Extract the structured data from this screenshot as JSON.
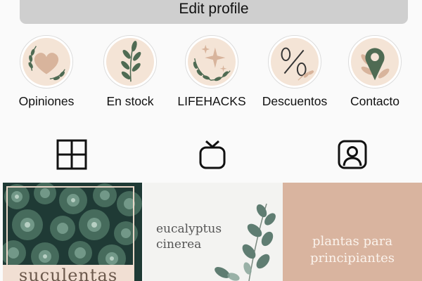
{
  "profile": {
    "edit_button_label": "Edit profile"
  },
  "highlights": [
    {
      "label": "Opiniones",
      "icon": "heart-wreath-icon"
    },
    {
      "label": "En stock",
      "icon": "leaf-branch-icon"
    },
    {
      "label": "LIFEHACKS",
      "icon": "sparkles-wreath-icon"
    },
    {
      "label": "Descuentos",
      "icon": "percent-icon"
    },
    {
      "label": "Contacto",
      "icon": "location-pin-icon"
    }
  ],
  "tabs": [
    {
      "icon": "grid-icon",
      "selected": true
    },
    {
      "icon": "tv-icon",
      "selected": false
    },
    {
      "icon": "tagged-user-icon",
      "selected": false
    }
  ],
  "posts": [
    {
      "caption": "suculentas",
      "image": "succulents-photo"
    },
    {
      "caption_line1": "eucalyptus",
      "caption_line2": "cinerea",
      "image": "eucalyptus-branch"
    },
    {
      "caption_line1": "plantas para",
      "caption_line2": "principiantes",
      "image": "beige-background"
    }
  ],
  "colors": {
    "button_bg": "#cfcfcf",
    "highlight_bg": "#f4e4d6",
    "highlight_icon_green": "#4f6b53",
    "highlight_icon_tan": "#d8b49c",
    "post3_bg": "#d9b49f"
  }
}
